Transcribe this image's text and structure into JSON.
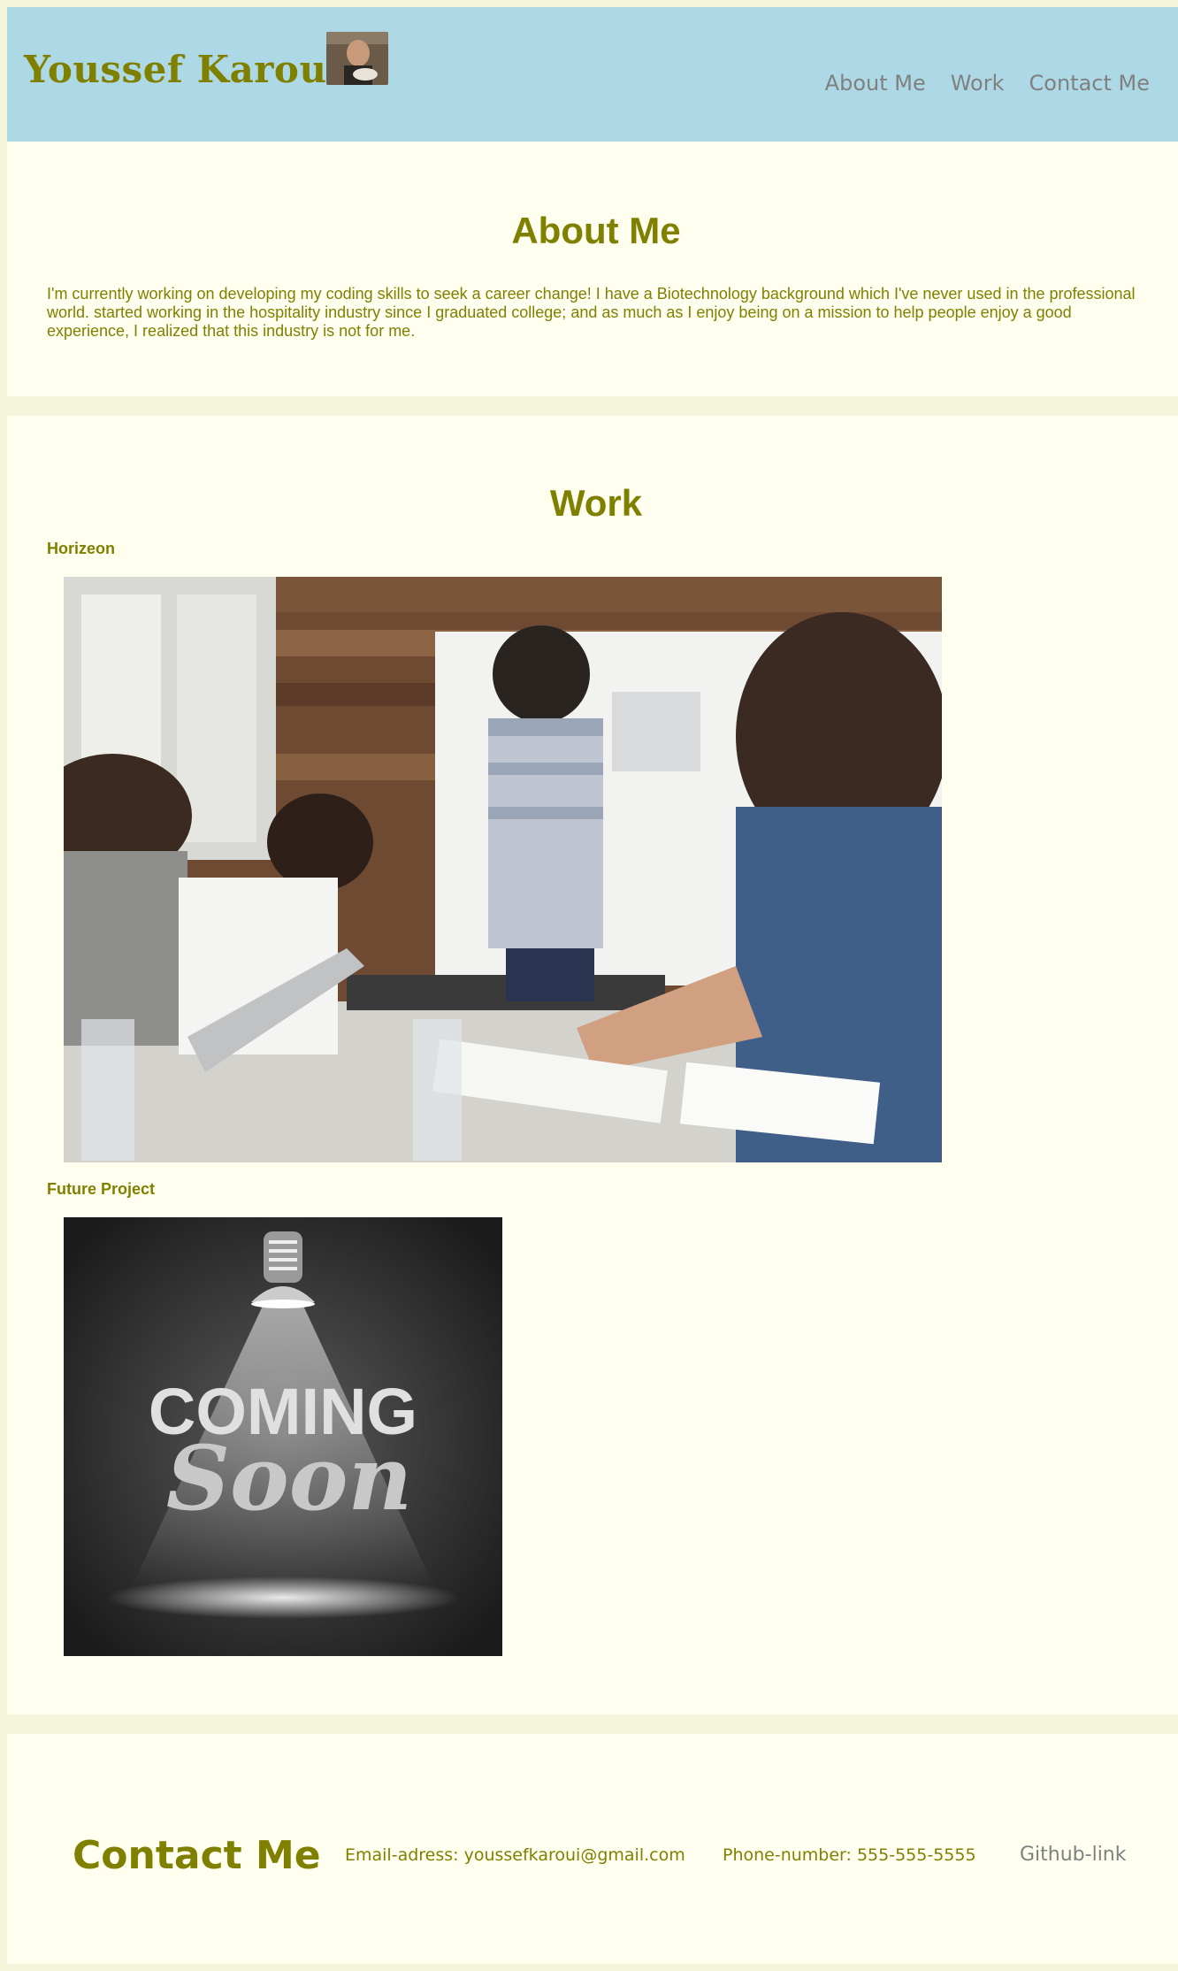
{
  "header": {
    "title": "Youssef Karoui",
    "nav": [
      "About Me",
      "Work",
      "Contact Me"
    ]
  },
  "about": {
    "title": "About Me",
    "text": "I'm currently working on developing my coding skills to seek a career change! I have a Biotechnology background which I've never used in the professional world. started working in the hospitality industry since I graduated college; and as much as I enjoy being on a mission to help people enjoy a good experience, I realized that this industry is not for me."
  },
  "work": {
    "title": "Work",
    "projects": [
      {
        "title": "Horizeon"
      },
      {
        "title": "Future Project",
        "image_text": [
          "COMING",
          "Soon"
        ]
      }
    ]
  },
  "contact": {
    "title": "Contact Me",
    "email": "Email-adress: youssefkaroui@gmail.com",
    "phone": "Phone-number: 555-555-5555",
    "github": "Github-link"
  },
  "colors": {
    "header_bg": "#add8e6",
    "accent": "#808000",
    "section_bg": "#fffff0",
    "page_bg": "#f5f5dc",
    "nav_text": "#808080"
  }
}
